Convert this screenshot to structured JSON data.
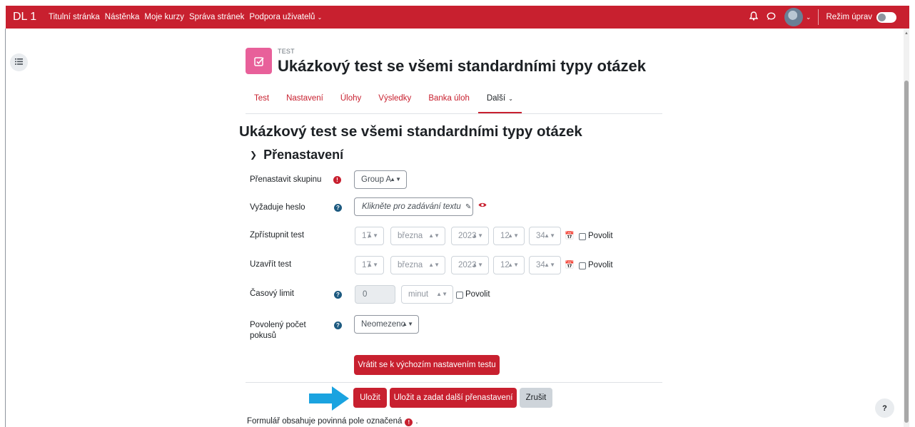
{
  "navbar": {
    "brand": "DL 1",
    "links": [
      "Titulní stránka",
      "Nástěnka",
      "Moje kurzy",
      "Správa stránek",
      "Podpora uživatelů"
    ],
    "edit_mode_label": "Režim úprav"
  },
  "header": {
    "activity_type": "TEST",
    "title": "Ukázkový test se všemi standardními typy otázek"
  },
  "tabs": [
    {
      "label": "Test"
    },
    {
      "label": "Nastavení"
    },
    {
      "label": "Úlohy"
    },
    {
      "label": "Výsledky"
    },
    {
      "label": "Banka úloh"
    },
    {
      "label": "Další",
      "active": true
    }
  ],
  "main": {
    "heading": "Ukázkový test se všemi standardními typy otázek",
    "section_title": "Přenastavení"
  },
  "form": {
    "group": {
      "label": "Přenastavit skupinu",
      "value": "Group A"
    },
    "password": {
      "label": "Vyžaduje heslo",
      "placeholder": "Klikněte pro zadávání textu"
    },
    "open": {
      "label": "Zpřístupnit test",
      "day": "17",
      "month": "března",
      "year": "2023",
      "hour": "12",
      "minute": "34",
      "enable_label": "Povolit"
    },
    "close": {
      "label": "Uzavřít test",
      "day": "17",
      "month": "března",
      "year": "2023",
      "hour": "12",
      "minute": "34",
      "enable_label": "Povolit"
    },
    "timelimit": {
      "label": "Časový limit",
      "value": "0",
      "unit": "minut",
      "enable_label": "Povolit"
    },
    "attempts": {
      "label": "Povolený počet pokusů",
      "value": "Neomezeno"
    },
    "revert_button": "Vrátit se k výchozím nastavením testu",
    "save_button": "Uložit",
    "save_another_button": "Uložit a zadat další přenastavení",
    "cancel_button": "Zrušit",
    "required_note_before": "Formulář obsahuje povinná pole označená",
    "required_note_after": "."
  },
  "icons": {
    "bell": "bell-icon",
    "chat": "chat-icon",
    "drawer": "list-icon",
    "calendar": "calendar-icon",
    "edit": "pencil-icon",
    "eye": "eye-icon",
    "help": "question-icon"
  },
  "colors": {
    "brand_red": "#c8202f",
    "quiz_icon_pink": "#e8609a",
    "help_blue": "#1d5a80",
    "pointer_arrow": "#1aa3e0"
  },
  "help_bubble": "?"
}
